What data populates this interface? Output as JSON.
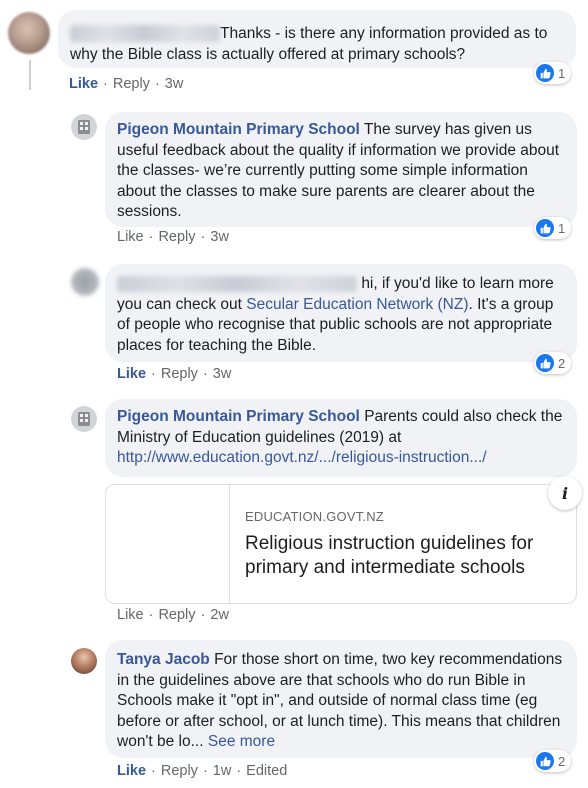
{
  "comments": [
    {
      "text": "Thanks - is there any information provided as to why the Bible class is actually offered at primary schools?",
      "actions": {
        "like": "Like",
        "reply": "Reply",
        "time": "3w"
      },
      "reaction_count": "1"
    },
    {
      "author": "Pigeon Mountain Primary School",
      "text": "The survey has given us useful feedback about the quality if information we provide about the classes- we’re currently putting some simple information about the classes to make sure parents are clearer about the sessions.",
      "actions": {
        "like": "Like",
        "reply": "Reply",
        "time": "3w"
      },
      "reaction_count": "1"
    },
    {
      "text_before_link": "hi, if you'd like to learn more you can check out",
      "link": "Secular Education Network (NZ)",
      "text_after_link": ". It's a group of people who recognise that public schools are not appropriate places for teaching the Bible.",
      "actions": {
        "like": "Like",
        "reply": "Reply",
        "time": "3w"
      },
      "reaction_count": "2"
    },
    {
      "author": "Pigeon Mountain Primary School",
      "text": "Parents could also check the Ministry of Education guidelines (2019) at",
      "url": "http://www.education.govt.nz/.../religious-instruction.../",
      "link_preview": {
        "domain": "EDUCATION.GOVT.NZ",
        "title": "Religious instruction guidelines for primary and intermediate schools",
        "info_icon": "info-icon"
      },
      "actions": {
        "like": "Like",
        "reply": "Reply",
        "time": "2w"
      }
    },
    {
      "author": "Tanya Jacob",
      "text": "For those short on time, two key recommendations in the guidelines above are that schools who do run Bible in Schools make it \"opt in\", and outside of normal class time (eg before or after school, or at lunch time). This means that children won't be lo...",
      "see_more": "See more",
      "actions": {
        "like": "Like",
        "reply": "Reply",
        "time": "1w",
        "edited": "Edited"
      },
      "reaction_count": "2"
    }
  ],
  "colors": {
    "bubble": "#f0f2f5",
    "link": "#385898",
    "meta": "#65676b",
    "like_blue": "#1877f2"
  },
  "icons": {
    "reaction": "thumbs-up-icon"
  }
}
